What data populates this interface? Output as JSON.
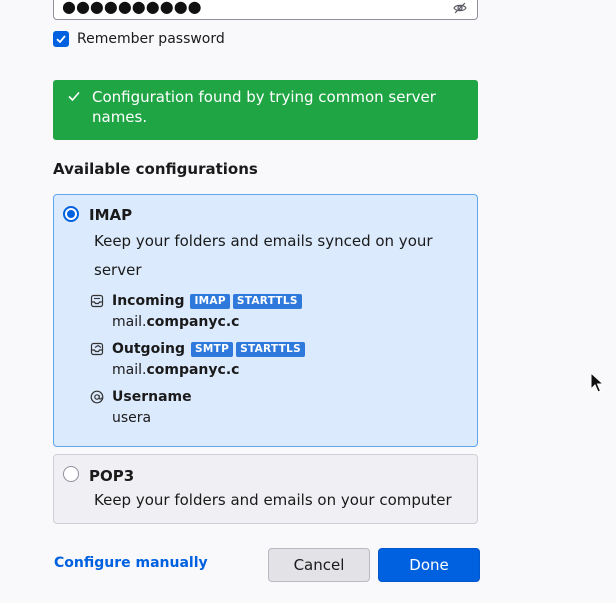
{
  "password": {
    "dots": "●●●●●●●●●●"
  },
  "remember": {
    "label": "Remember password",
    "checked": true
  },
  "success_banner": {
    "text": "Configuration found by trying common server names."
  },
  "section_title": "Available configurations",
  "configs": [
    {
      "title": "IMAP",
      "description": "Keep your folders and emails synced on your server",
      "selected": true,
      "incoming": {
        "label": "Incoming",
        "tags": [
          "IMAP",
          "STARTTLS"
        ],
        "host_prefix": "mail.",
        "host_domain": "companyc.c"
      },
      "outgoing": {
        "label": "Outgoing",
        "tags": [
          "SMTP",
          "STARTTLS"
        ],
        "host_prefix": "mail.",
        "host_domain": "companyc.c"
      },
      "username": {
        "label": "Username",
        "value": "usera"
      }
    },
    {
      "title": "POP3",
      "description": "Keep your folders and emails on your computer",
      "selected": false
    }
  ],
  "footer": {
    "configure_manually": "Configure manually",
    "cancel": "Cancel",
    "done": "Done"
  },
  "colors": {
    "accent": "#0061e0",
    "success": "#20a545",
    "selected_card": "#dbeafd",
    "tag": "#2f79dc"
  },
  "icons": {
    "password_toggle": "eye-slash-icon",
    "success": "check-icon",
    "incoming": "inbox-icon",
    "outgoing": "outbox-icon",
    "username": "at-sign-icon"
  }
}
